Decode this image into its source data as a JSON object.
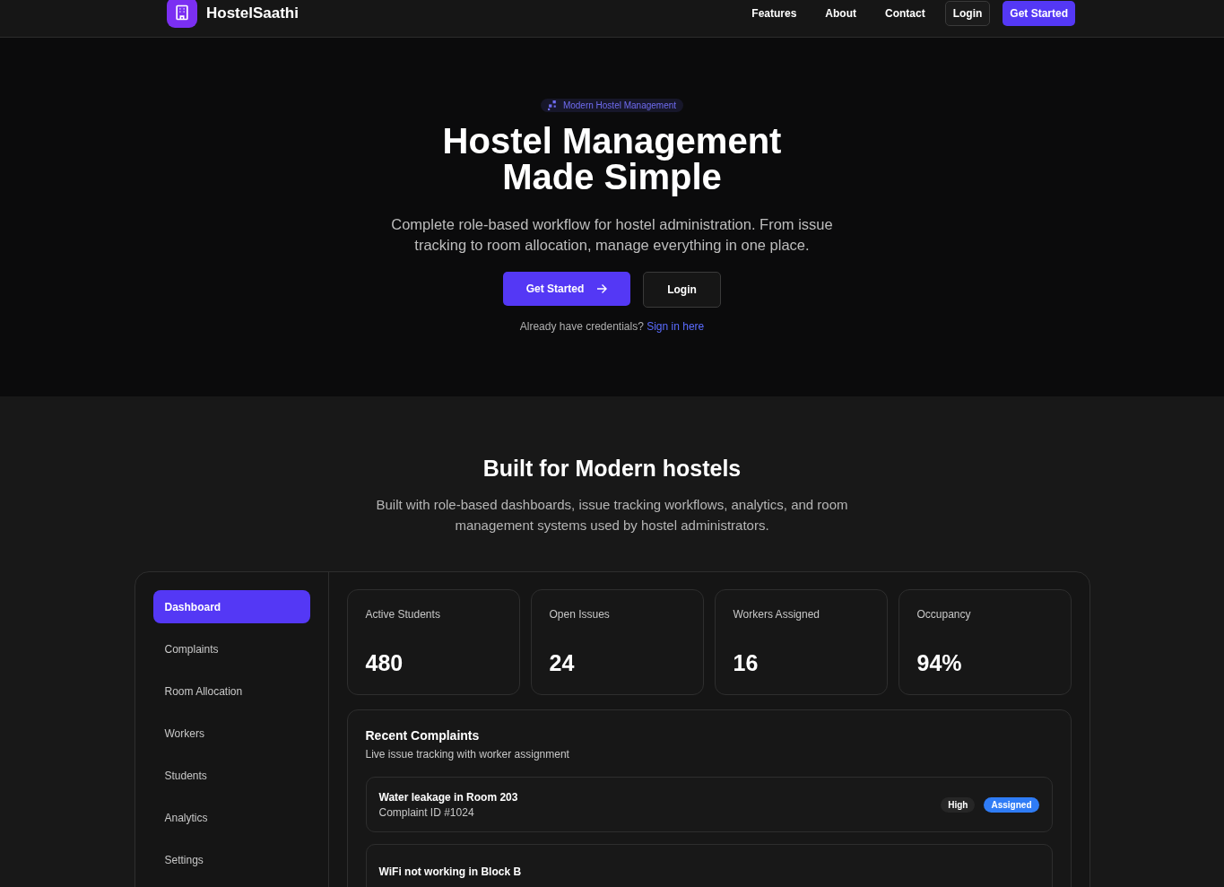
{
  "nav": {
    "brand": "HostelSaathi",
    "links": [
      "Features",
      "About",
      "Contact"
    ],
    "login": "Login",
    "cta": "Get Started"
  },
  "hero": {
    "badge": "Modern Hostel Management",
    "title_lines": [
      "Hostel Management",
      "Made Simple"
    ],
    "subtitle": "Complete role-based workflow for hostel administration. From issue tracking to room allocation, manage everything in one place.",
    "primary": "Get Started",
    "secondary": "Login",
    "note": "Already have credentials?",
    "note_link": "Sign in here"
  },
  "section": {
    "title": "Built for Modern hostels",
    "subtitle": "Built with role-based dashboards, issue tracking workflows, analytics, and room management systems used by hostel administrators."
  },
  "sidebar": {
    "items": [
      {
        "label": "Dashboard",
        "selected": true
      },
      {
        "label": "Complaints",
        "selected": false
      },
      {
        "label": "Room Allocation",
        "selected": false
      },
      {
        "label": "Workers",
        "selected": false
      },
      {
        "label": "Students",
        "selected": false
      },
      {
        "label": "Analytics",
        "selected": false
      },
      {
        "label": "Settings",
        "selected": false
      }
    ]
  },
  "stats": [
    {
      "label": "Active Students",
      "value": "480"
    },
    {
      "label": "Open Issues",
      "value": "24"
    },
    {
      "label": "Workers Assigned",
      "value": "16"
    },
    {
      "label": "Occupancy",
      "value": "94%"
    }
  ],
  "complaints": {
    "title": "Recent Complaints",
    "subtitle": "Live issue tracking with worker assignment",
    "items": [
      {
        "title": "Water leakage in Room 203",
        "id": "Complaint ID #1024",
        "priority": "High",
        "status": "Assigned",
        "color": "#2f7cf6"
      },
      {
        "title": "WiFi not working in Block B"
      }
    ]
  }
}
